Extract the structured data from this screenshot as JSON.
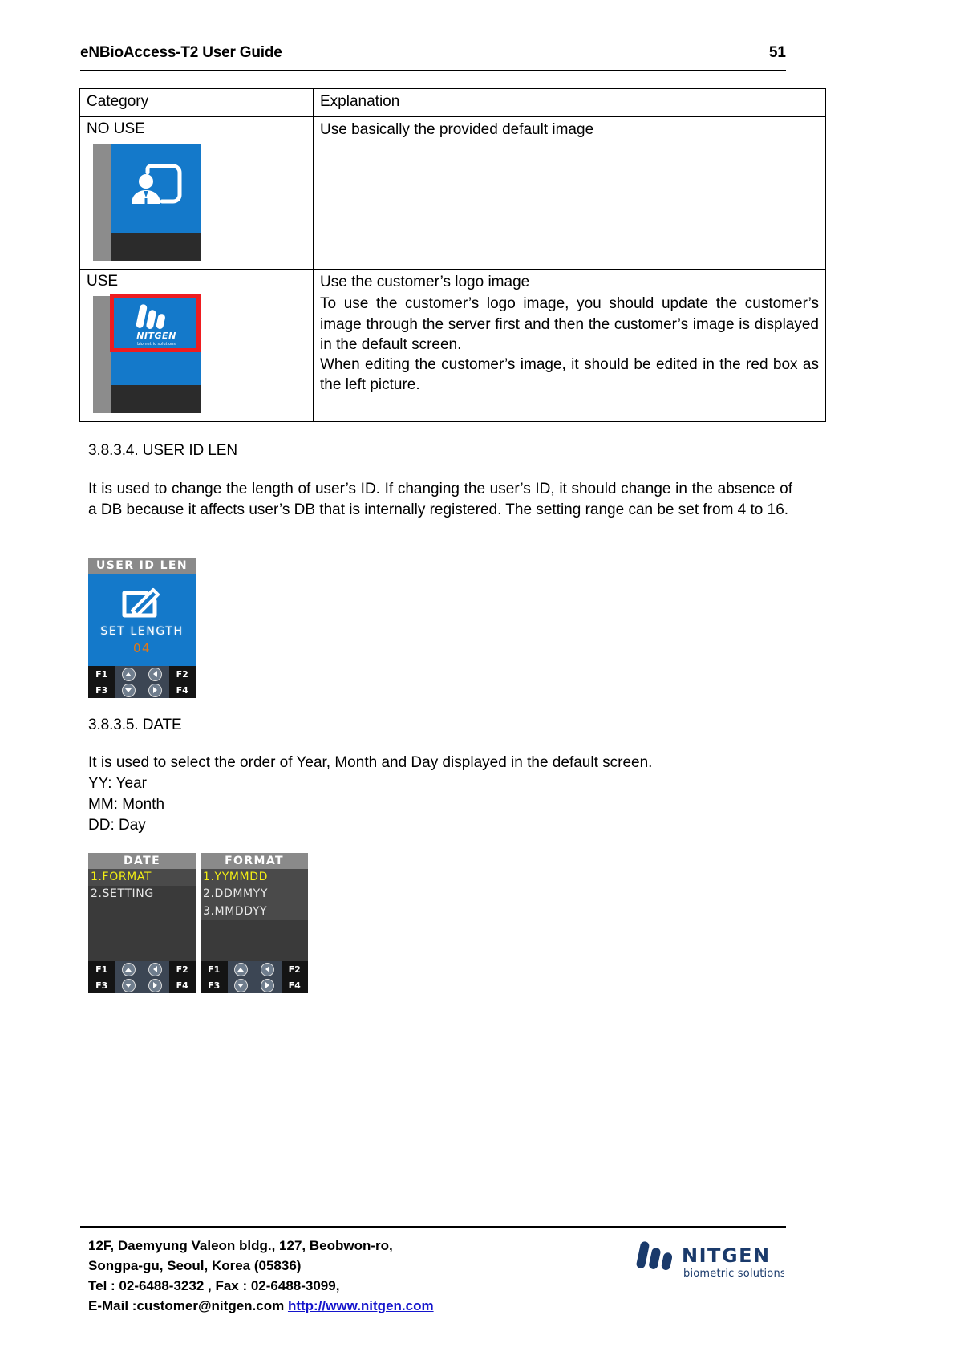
{
  "header": {
    "title": "eNBioAccess-T2 User Guide",
    "page_number": "51"
  },
  "table": {
    "columns": [
      "Category",
      "Explanation"
    ],
    "rows": [
      {
        "category": "NO USE",
        "explanation_lines": [
          "Use basically the provided default image"
        ],
        "device_preview": {
          "type": "default-screen-no-logo",
          "icon": "user-badge-icon",
          "screen_color": "#1479ca",
          "bottom_color": "#2b2b2b",
          "side_color": "#8c8c8c",
          "red_box": false
        }
      },
      {
        "category": "USE",
        "explanation_lines": [
          "Use the customer’s logo image",
          "To use the customer’s logo image, you should update the customer’s image through the server first and then the customer’s image is displayed in the default screen.",
          "When editing the customer’s image, it should be edited in the red box as the left picture."
        ],
        "device_preview": {
          "type": "default-screen-with-logo",
          "icon": "nitgen-logo-icon",
          "logo_text": "NITGEN",
          "logo_subtext": "biometric solutions",
          "screen_color": "#1479ca",
          "bottom_color": "#2b2b2b",
          "side_color": "#8c8c8c",
          "red_box": true,
          "red_box_color": "#ee1c20"
        }
      }
    ]
  },
  "sections": [
    {
      "heading": "3.8.3.4. USER ID LEN",
      "body": "It is used to change the length of user’s ID. If changing the user’s ID, it should change in the absence of a DB because it affects user’s DB that is internally registered. The setting range can be set from 4 to 16."
    },
    {
      "heading": "3.8.3.5. DATE",
      "body_lines": [
        "It is used to select the order of Year, Month and Day displayed in the default screen.",
        "YY: Year",
        "MM: Month",
        "DD: Day"
      ]
    }
  ],
  "terminals": {
    "user_id_len": {
      "title": "USER ID LEN",
      "icon": "edit-pencil-icon",
      "label": "SET LENGTH",
      "value": "04",
      "value_color": "#e07818",
      "title_bg": "#8a8a8a",
      "screen_bg": "#1479ca",
      "keys": [
        [
          "F1",
          "up-arrow-icon",
          "left-arrow-icon",
          "F2"
        ],
        [
          "F3",
          "down-arrow-icon",
          "right-arrow-icon",
          "F4"
        ]
      ]
    },
    "date_menu": {
      "title": "DATE",
      "items": [
        {
          "label": "1.FORMAT",
          "selected": true
        },
        {
          "label": "2.SETTING",
          "selected": false
        }
      ],
      "keys": [
        [
          "F1",
          "up-arrow-icon",
          "left-arrow-icon",
          "F2"
        ],
        [
          "F3",
          "down-arrow-icon",
          "right-arrow-icon",
          "F4"
        ]
      ]
    },
    "format_menu": {
      "title": "FORMAT",
      "items": [
        {
          "label": "1.YYMMDD",
          "selected": true
        },
        {
          "label": "2.DDMMYY",
          "selected": false
        },
        {
          "label": "3.MMDDYY",
          "selected": false
        }
      ],
      "keys": [
        [
          "F1",
          "up-arrow-icon",
          "left-arrow-icon",
          "F2"
        ],
        [
          "F3",
          "down-arrow-icon",
          "right-arrow-icon",
          "F4"
        ]
      ]
    }
  },
  "footer": {
    "address_line1": "12F, Daemyung Valeon bldg., 127, Beobwon-ro,",
    "address_line2": "Songpa-gu, Seoul, Korea (05836)",
    "contact_line": "Tel : 02-6488-3232 , Fax : 02-6488-3099,",
    "email_label": "E-Mail :customer@nitgen.com",
    "website": "http://www.nitgen.com",
    "logo_text": "NITGEN",
    "logo_subtext": "biometric solutions",
    "logo_color": "#1a3a6b"
  }
}
